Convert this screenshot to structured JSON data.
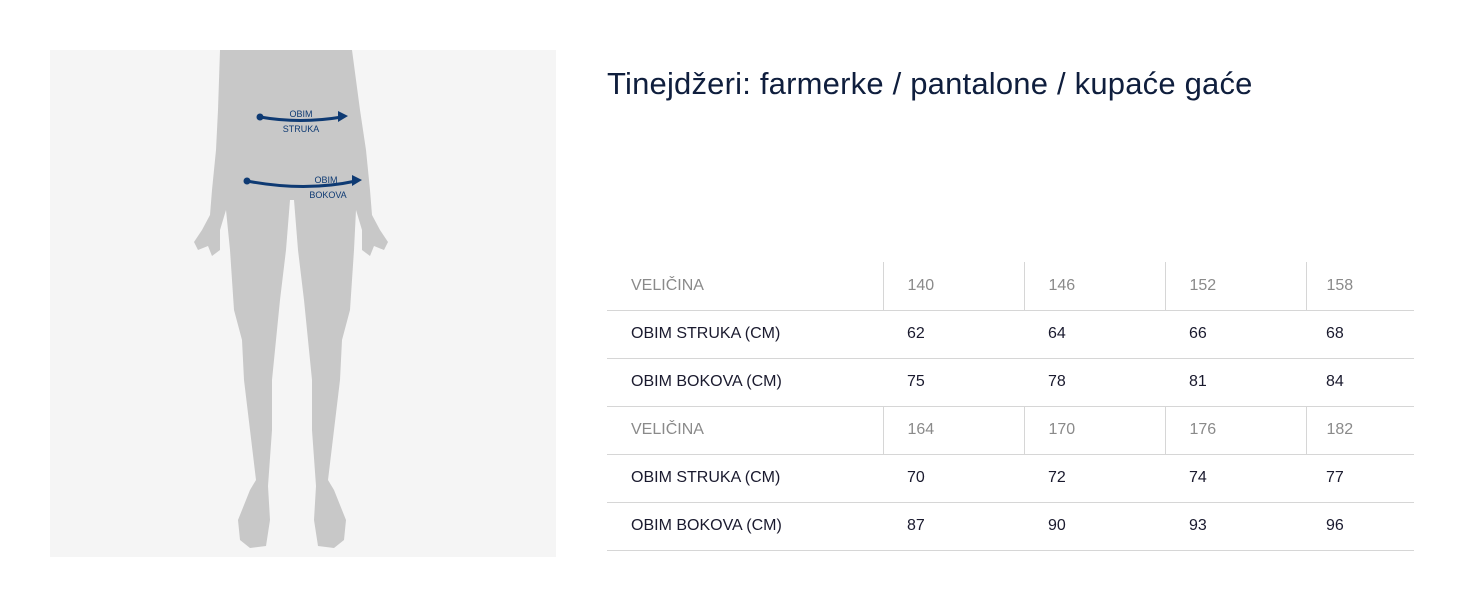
{
  "title": "Tinejdžeri: farmerke / pantalone / kupaće gaće",
  "figure": {
    "waist_label_line1": "OBIM",
    "waist_label_line2": "STRUKA",
    "hip_label_line1": "OBIM",
    "hip_label_line2": "BOKOVA"
  },
  "table": {
    "blocks": [
      {
        "header_label": "VELIČINA",
        "sizes": [
          "140",
          "146",
          "152",
          "158"
        ],
        "rows": [
          {
            "label": "OBIM STRUKA (CM)",
            "values": [
              "62",
              "64",
              "66",
              "68"
            ]
          },
          {
            "label": "OBIM BOKOVA (CM)",
            "values": [
              "75",
              "78",
              "81",
              "84"
            ]
          }
        ]
      },
      {
        "header_label": "VELIČINA",
        "sizes": [
          "164",
          "170",
          "176",
          "182"
        ],
        "rows": [
          {
            "label": "OBIM STRUKA (CM)",
            "values": [
              "70",
              "72",
              "74",
              "77"
            ]
          },
          {
            "label": "OBIM BOKOVA (CM)",
            "values": [
              "87",
              "90",
              "93",
              "96"
            ]
          }
        ]
      }
    ]
  },
  "colors": {
    "accent": "#0e3a73",
    "silhouette": "#c8c8c8",
    "panel_bg": "#f5f5f5"
  }
}
